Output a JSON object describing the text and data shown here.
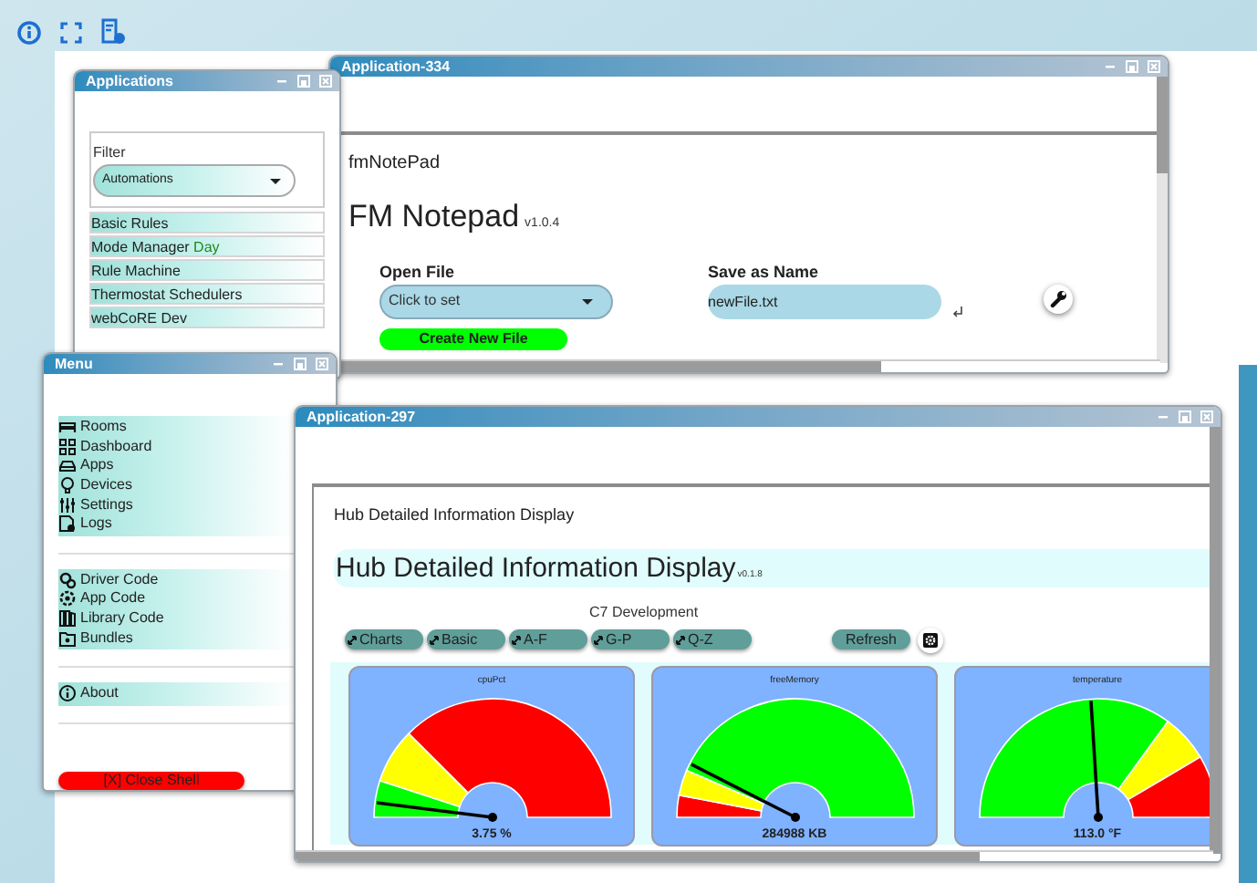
{
  "windows": [
    {
      "kind": "applications",
      "title": "Applications",
      "filter_label": "Filter",
      "filter_value": "Automations",
      "items": [
        {
          "label": "Basic Rules"
        },
        {
          "label": "Mode Manager",
          "status": "Day"
        },
        {
          "label": "Rule Machine"
        },
        {
          "label": "Thermostat Schedulers"
        },
        {
          "label": "webCoRE Dev"
        }
      ]
    },
    {
      "kind": "notepad",
      "title": "Application-334",
      "app_name": "fmNotePad",
      "heading": "FM Notepad",
      "version": "v1.0.4",
      "open_file_label": "Open File",
      "open_file_value": "Click to set",
      "save_label": "Save as Name",
      "save_value": "newFile.txt",
      "create_button": "Create New File"
    },
    {
      "kind": "menu",
      "title": "Menu",
      "groups": [
        {
          "items": [
            {
              "label": "Rooms"
            },
            {
              "label": "Dashboard"
            },
            {
              "label": "Apps"
            },
            {
              "label": "Devices"
            },
            {
              "label": "Settings"
            },
            {
              "label": "Logs"
            }
          ]
        },
        {
          "items": [
            {
              "label": "Driver Code"
            },
            {
              "label": "App Code"
            },
            {
              "label": "Library Code"
            },
            {
              "label": "Bundles"
            }
          ]
        },
        {
          "items": [
            {
              "label": "About"
            }
          ]
        }
      ],
      "close_button": "[X] Close Shell"
    },
    {
      "kind": "hub",
      "title": "Application-297",
      "app_name": "Hub Detailed Information Display",
      "heading": "Hub Detailed Information Display",
      "version": "v0.1.8",
      "hub_name": "C7 Development",
      "tabs": [
        {
          "label": "Charts"
        },
        {
          "label": "Basic"
        },
        {
          "label": "A-F"
        },
        {
          "label": "G-P"
        },
        {
          "label": "Q-Z"
        }
      ],
      "refresh_button": "Refresh",
      "gauges": [
        {
          "title": "cpuPct",
          "reading": "3.75 %"
        },
        {
          "title": "freeMemory",
          "reading": "284988 KB"
        },
        {
          "title": "temperature",
          "reading": "113.0 °F"
        }
      ]
    }
  ]
}
